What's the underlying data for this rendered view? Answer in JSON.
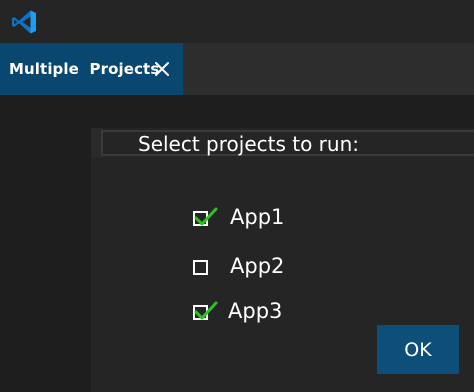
{
  "window": {
    "logo_icon": "vscode-logo-icon",
    "accent_color": "#0e4f7a"
  },
  "tab": {
    "label": "Multiple  Projects",
    "close_icon": "close-icon",
    "active_color": "#094771"
  },
  "dialog": {
    "title": "Select projects to run:",
    "options": [
      {
        "label": "App1",
        "checked": true
      },
      {
        "label": "App2",
        "checked": false
      },
      {
        "label": "App3",
        "checked": true
      }
    ],
    "ok_label": "OK",
    "check_color": "#2ec020"
  }
}
